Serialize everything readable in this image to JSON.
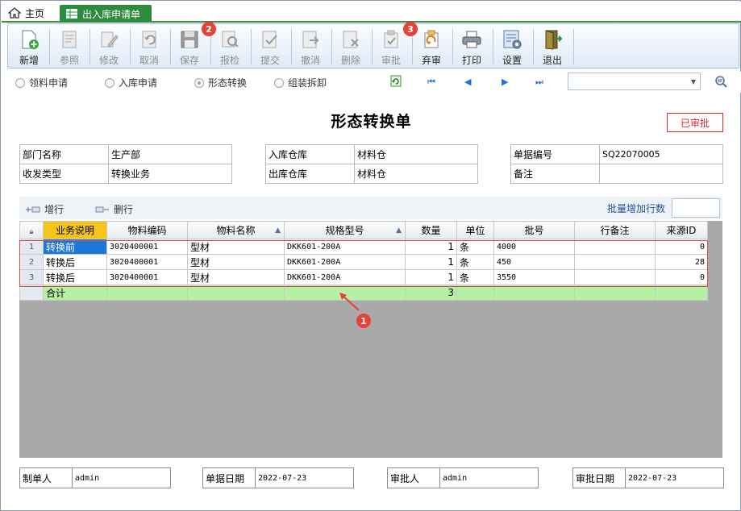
{
  "tabs": {
    "home_label": "主页",
    "active_label": "出入库申请单"
  },
  "toolbar": {
    "buttons": [
      {
        "label": "新增",
        "icon": "new-doc-icon",
        "enabled": true
      },
      {
        "label": "参照",
        "icon": "reference-icon",
        "enabled": false
      },
      {
        "label": "修改",
        "icon": "edit-icon",
        "enabled": false
      },
      {
        "label": "取消",
        "icon": "undo-icon",
        "enabled": false
      },
      {
        "label": "保存",
        "icon": "save-icon",
        "enabled": false
      },
      {
        "label": "报检",
        "icon": "inspect-icon",
        "enabled": false
      },
      {
        "label": "提交",
        "icon": "submit-icon",
        "enabled": false
      },
      {
        "label": "撤消",
        "icon": "revoke-icon",
        "enabled": false
      },
      {
        "label": "删除",
        "icon": "delete-icon",
        "enabled": false
      },
      {
        "label": "审批",
        "icon": "approve-icon",
        "enabled": false
      },
      {
        "label": "弃审",
        "icon": "unapprove-icon",
        "enabled": true
      },
      {
        "label": "打印",
        "icon": "print-icon",
        "enabled": true
      },
      {
        "label": "设置",
        "icon": "settings-icon",
        "enabled": true
      },
      {
        "label": "退出",
        "icon": "exit-icon",
        "enabled": true
      }
    ],
    "badges": [
      "2",
      "3"
    ]
  },
  "mode_radios": [
    {
      "label": "领料申请",
      "selected": false
    },
    {
      "label": "入库申请",
      "selected": false
    },
    {
      "label": "形态转换",
      "selected": true
    },
    {
      "label": "组装拆卸",
      "selected": false
    }
  ],
  "nav": {
    "refresh_icon": "refresh-icon",
    "first": "⏮",
    "prev": "◀",
    "next": "▶",
    "last": "⏭",
    "combo_value": "",
    "search_icon": "search-config-icon"
  },
  "doc": {
    "title": "形态转换单",
    "status": "已审批"
  },
  "info": {
    "left": [
      {
        "key": "部门名称",
        "value": "生产部"
      },
      {
        "key": "收发类型",
        "value": "转换业务"
      }
    ],
    "middle": [
      {
        "key": "入库仓库",
        "value": "材料仓"
      },
      {
        "key": "出库仓库",
        "value": "材料仓"
      }
    ],
    "right": [
      {
        "key": "单据编号",
        "value": "SQ22070005"
      },
      {
        "key": "备注",
        "value": ""
      }
    ]
  },
  "grid_toolbar": {
    "add_row": "增行",
    "delete_row": "删行",
    "batch_label": "批量增加行数",
    "batch_value": ""
  },
  "grid": {
    "columns": [
      "业务说明",
      "物料编码",
      "物料名称",
      "规格型号",
      "数量",
      "单位",
      "批号",
      "行备注",
      "来源ID"
    ],
    "rows": [
      {
        "no": "1",
        "cells": [
          "转换前",
          "3020400001",
          "型材",
          "DKK601-200A",
          "1",
          "条",
          "4000",
          "",
          "0"
        ]
      },
      {
        "no": "2",
        "cells": [
          "转换后",
          "3020400001",
          "型材",
          "DKK601-200A",
          "1",
          "条",
          "450",
          "",
          "28"
        ]
      },
      {
        "no": "3",
        "cells": [
          "转换后",
          "3020400001",
          "型材",
          "DKK601-200A",
          "1",
          "条",
          "3550",
          "",
          "0"
        ]
      }
    ],
    "total": {
      "label": "合计",
      "qty": "3"
    },
    "annotation": "1"
  },
  "footer": [
    {
      "key": "制单人",
      "value": "admin"
    },
    {
      "key": "单据日期",
      "value": "2022-07-23"
    },
    {
      "key": "审批人",
      "value": "admin"
    },
    {
      "key": "审批日期",
      "value": "2022-07-23"
    }
  ]
}
